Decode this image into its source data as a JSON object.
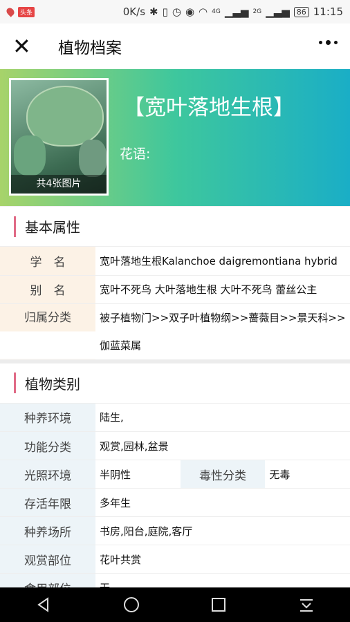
{
  "status_bar": {
    "network_speed": "0K/s",
    "net1": "4G",
    "net2": "2G",
    "battery": "86",
    "time": "11:15",
    "news_badge": "头条"
  },
  "header": {
    "title": "植物档案"
  },
  "hero": {
    "plant_name": "【宽叶落地生根】",
    "flower_language_label": "花语:",
    "image_count_caption": "共4张图片"
  },
  "basic": {
    "section_title": "基本属性",
    "rows": [
      {
        "label": "学　名",
        "value": "宽叶落地生根Kalanchoe daigremontiana hybrid"
      },
      {
        "label": "别　名",
        "value": "宽叶不死鸟 大叶落地生根 大叶不死鸟 蕾丝公主"
      },
      {
        "label": "归属分类",
        "value": "被子植物门>>双子叶植物纲>>蔷薇目>>景天科>>伽蓝菜属"
      }
    ]
  },
  "category": {
    "section_title": "植物类别",
    "rows": [
      {
        "label": "种养环境",
        "value": "陆生,"
      },
      {
        "label": "功能分类",
        "value": "观赏,园林,盆景"
      },
      {
        "label": "光照环境",
        "value": "半阴性",
        "label2": "毒性分类",
        "value2": "无毒"
      },
      {
        "label": "存活年限",
        "value": "多年生"
      },
      {
        "label": "种养场所",
        "value": "书房,阳台,庭院,客厅"
      },
      {
        "label": "观赏部位",
        "value": "花叶共赏"
      },
      {
        "label": "食用部位",
        "value": "无"
      }
    ]
  },
  "colors": {
    "accent": "#e06a86",
    "hero_gradient_start": "#a7d36a",
    "hero_gradient_end": "#1aaec6"
  }
}
